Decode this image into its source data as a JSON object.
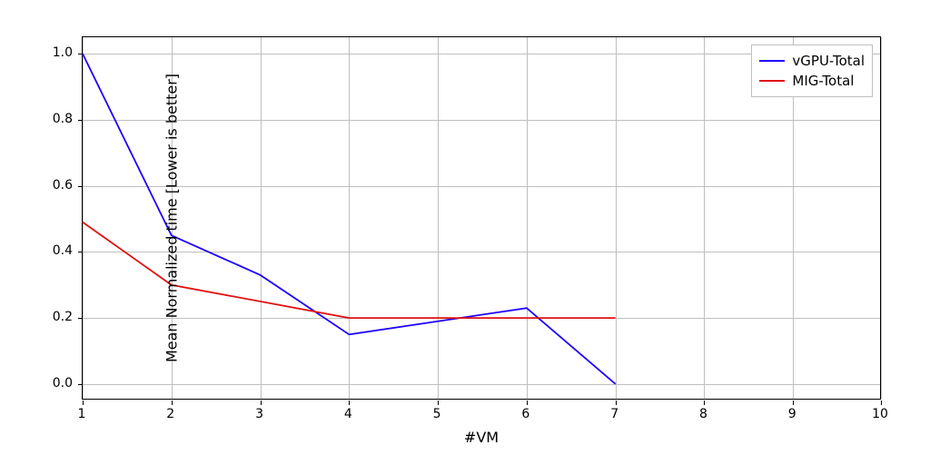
{
  "chart_data": {
    "type": "line",
    "xlabel": "#VM",
    "ylabel": "Mean Normalized time [Lower is better]",
    "title": "",
    "xlim": [
      1,
      10
    ],
    "ylim": [
      -0.05,
      1.05
    ],
    "x_ticks": [
      1,
      2,
      3,
      4,
      5,
      6,
      7,
      8,
      9,
      10
    ],
    "y_ticks": [
      0.0,
      0.2,
      0.4,
      0.6,
      0.8,
      1.0
    ],
    "y_tick_labels": [
      "0.0",
      "0.2",
      "0.4",
      "0.6",
      "0.8",
      "1.0"
    ],
    "series": [
      {
        "name": "vGPU-Total",
        "color": "#1f00ff",
        "x": [
          1,
          2,
          3,
          4,
          5,
          6,
          7
        ],
        "values": [
          1.0,
          0.45,
          0.33,
          0.15,
          0.19,
          0.23,
          0.0
        ]
      },
      {
        "name": "MIG-Total",
        "color": "#e01010",
        "x": [
          1,
          2,
          3,
          4,
          5,
          6,
          7
        ],
        "values": [
          0.49,
          0.3,
          0.25,
          0.2,
          0.2,
          0.2,
          0.2
        ]
      }
    ],
    "legend": {
      "position": "upper-right",
      "entries": [
        "vGPU-Total",
        "MIG-Total"
      ]
    }
  }
}
